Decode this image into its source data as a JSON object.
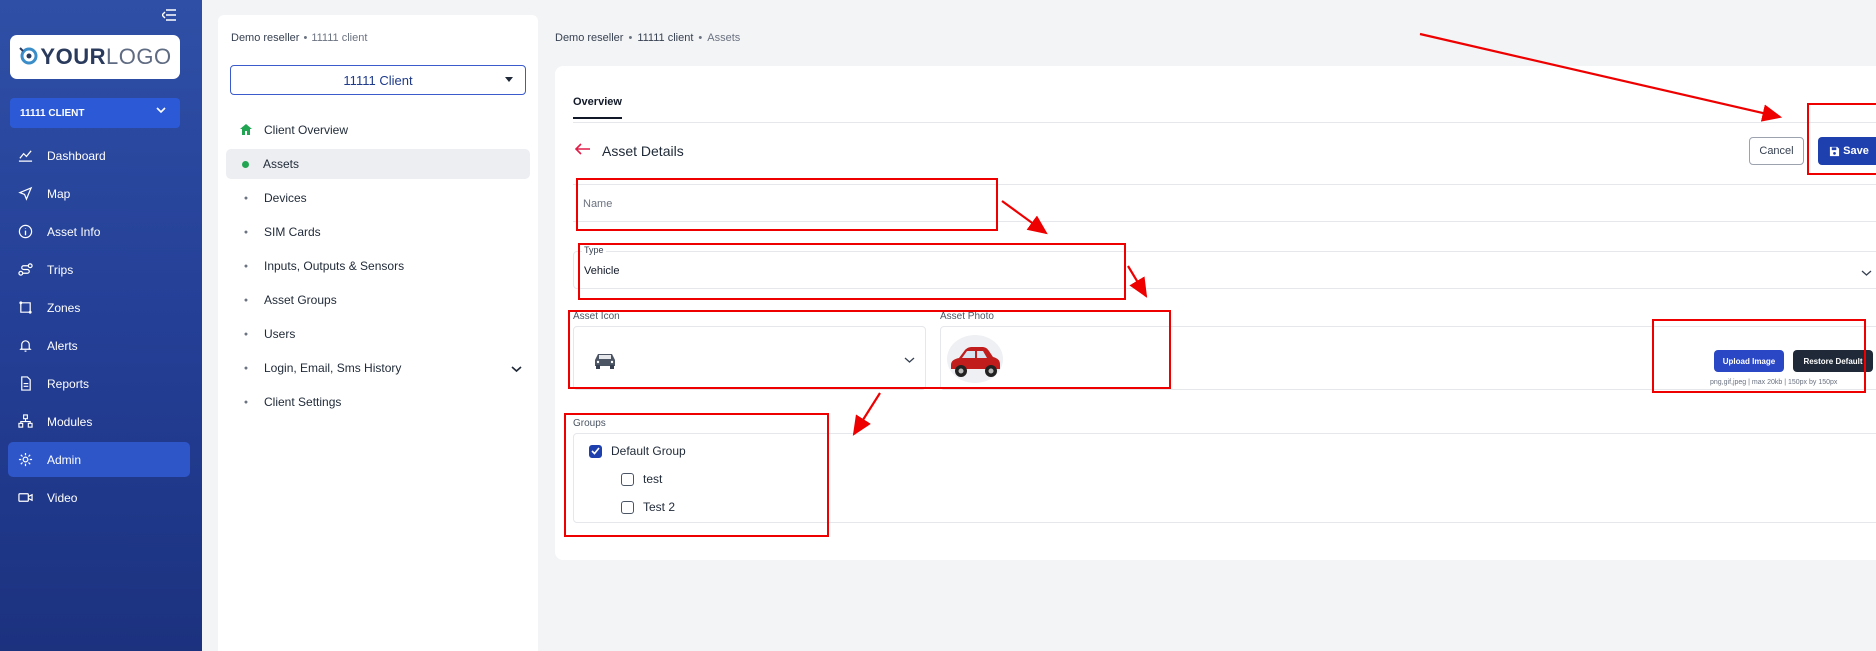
{
  "sidebar": {
    "logo": {
      "part1": "YOUR",
      "part2": "LOGO"
    },
    "client_select": "11111 CLIENT",
    "items": [
      {
        "label": "Dashboard",
        "icon": "chart-line-icon"
      },
      {
        "label": "Map",
        "icon": "navigation-icon"
      },
      {
        "label": "Asset Info",
        "icon": "info-icon"
      },
      {
        "label": "Trips",
        "icon": "route-icon"
      },
      {
        "label": "Zones",
        "icon": "zone-icon"
      },
      {
        "label": "Alerts",
        "icon": "bell-icon"
      },
      {
        "label": "Reports",
        "icon": "report-icon"
      },
      {
        "label": "Modules",
        "icon": "modules-icon"
      },
      {
        "label": "Admin",
        "icon": "gear-icon",
        "active": true
      },
      {
        "label": "Video",
        "icon": "video-icon"
      }
    ]
  },
  "client_panel": {
    "breadcrumb": {
      "reseller": "Demo reseller",
      "client": "11111 client"
    },
    "select_value": "11111 Client",
    "menu": [
      {
        "label": "Client Overview"
      },
      {
        "label": "Assets"
      },
      {
        "label": "Devices"
      },
      {
        "label": "SIM Cards"
      },
      {
        "label": "Inputs, Outputs & Sensors"
      },
      {
        "label": "Asset Groups"
      },
      {
        "label": "Users"
      },
      {
        "label": "Login, Email, Sms History"
      },
      {
        "label": "Client Settings"
      }
    ]
  },
  "main": {
    "breadcrumb": {
      "reseller": "Demo reseller",
      "client": "11111 client",
      "page": "Assets"
    },
    "tab": "Overview",
    "title": "Asset Details",
    "cancel_label": "Cancel",
    "save_label": "Save",
    "name_placeholder": "Name",
    "type_label": "Type",
    "type_value": "Vehicle",
    "asset_icon_label": "Asset Icon",
    "asset_photo_label": "Asset Photo",
    "upload_label": "Upload Image",
    "restore_label": "Restore Default",
    "photo_hint": "png,gif,jpeg | max 20kb | 150px by 150px",
    "groups_label": "Groups",
    "groups": [
      {
        "label": "Default Group",
        "checked": true
      },
      {
        "label": "test",
        "checked": false
      },
      {
        "label": "Test 2",
        "checked": false
      }
    ]
  },
  "colors": {
    "sidebar_bg": "#2a479e",
    "accent": "#1e40af",
    "annotation": "#ee0000"
  }
}
